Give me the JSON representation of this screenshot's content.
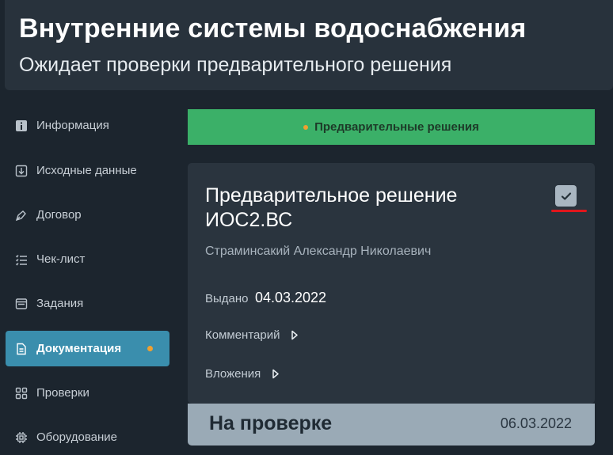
{
  "header": {
    "title": "Внутренние системы водоснабжения",
    "subtitle": "Ожидает проверки предварительного решения"
  },
  "sidebar": {
    "items": [
      {
        "label": "Информация",
        "icon": "info-icon"
      },
      {
        "label": "Исходные данные",
        "icon": "download-icon"
      },
      {
        "label": "Договор",
        "icon": "pen-icon"
      },
      {
        "label": "Чек-лист",
        "icon": "checklist-icon"
      },
      {
        "label": "Задания",
        "icon": "tasks-icon"
      },
      {
        "label": "Документация",
        "icon": "document-icon",
        "active": true,
        "badge_color": "#f0a030"
      },
      {
        "label": "Проверки",
        "icon": "grid-icon"
      },
      {
        "label": "Оборудование",
        "icon": "chip-icon"
      }
    ]
  },
  "banner": {
    "label": "Предварительные решения",
    "color": "#3bb068"
  },
  "card": {
    "title": "Предварительное решение ИОС2.ВС",
    "author": "Страминсакий Александр Николаевич",
    "issued_label": "Выдано",
    "issued_date": "04.03.2022",
    "comment_label": "Комментарий",
    "attachments_label": "Вложения",
    "check_icon": "checkmark-icon"
  },
  "status": {
    "label": "На проверке",
    "date": "06.03.2022"
  },
  "colors": {
    "accent": "#3a8ead",
    "badge": "#f0a030",
    "underline": "#e0161c"
  }
}
